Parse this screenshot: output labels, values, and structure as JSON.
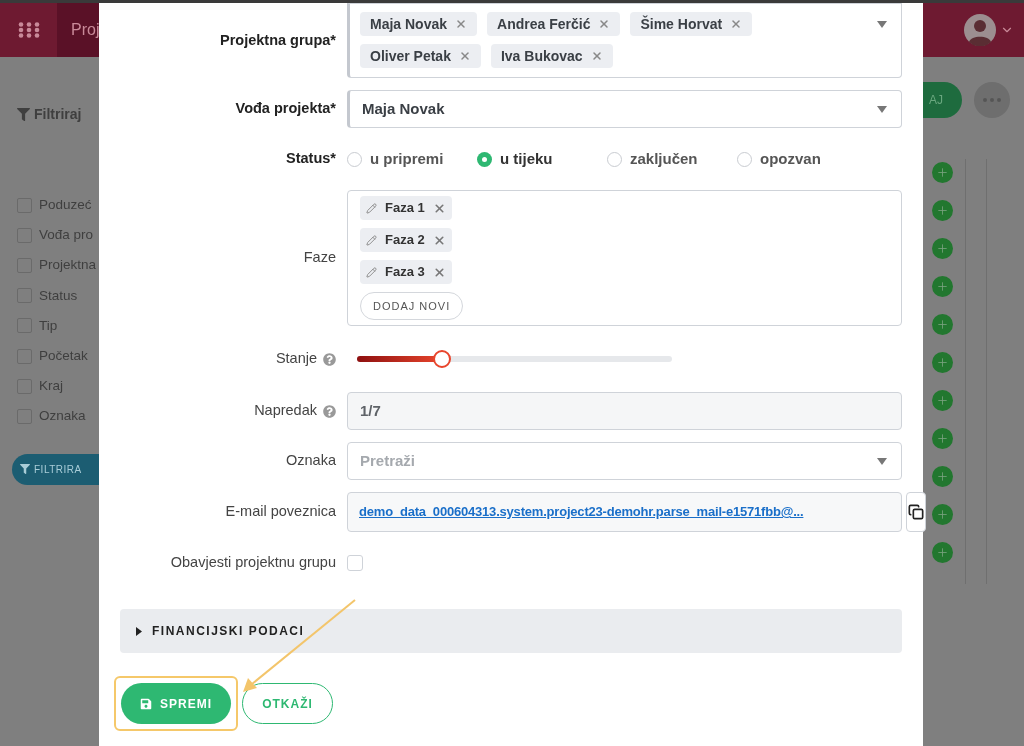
{
  "background": {
    "header": {
      "title": "Proj"
    },
    "filter": {
      "title": "Filtriraj",
      "button": "FILTRIRA",
      "items": [
        {
          "label": "Poduzeć",
          "checked": false
        },
        {
          "label": "Vođa pro",
          "checked": false
        },
        {
          "label": "Projektna",
          "checked": false
        },
        {
          "label": "Status",
          "checked": false
        },
        {
          "label": "Tip",
          "checked": false
        },
        {
          "label": "Početak",
          "checked": false
        },
        {
          "label": "Kraj",
          "checked": false
        },
        {
          "label": "Oznaka",
          "checked": false
        }
      ]
    },
    "add_button": "AJ"
  },
  "form": {
    "fields": [
      {
        "kind": "tags",
        "label": "Projektna grupa*",
        "required": true,
        "tags": [
          "Maja Novak",
          "Andrea Ferčić",
          "Šime Horvat",
          "Oliver Petak",
          "Iva Bukovac"
        ]
      },
      {
        "kind": "select",
        "label": "Vođa projekta*",
        "required": true,
        "value": "Maja Novak"
      },
      {
        "kind": "radio",
        "label": "Status*",
        "required": true,
        "options": [
          {
            "label": "u pripremi",
            "selected": false
          },
          {
            "label": "u tijeku",
            "selected": true
          },
          {
            "label": "zaključen",
            "selected": false
          },
          {
            "label": "opozvan",
            "selected": false
          }
        ]
      },
      {
        "kind": "phases",
        "label": "Faze",
        "required": false,
        "phases": [
          "Faza 1",
          "Faza 2",
          "Faza 3"
        ],
        "add_button": "DODAJ NOVI"
      },
      {
        "kind": "slider",
        "label": "Stanje",
        "required": false,
        "help": true,
        "level": 0.27
      },
      {
        "kind": "readonly",
        "label": "Napredak",
        "required": false,
        "help": true,
        "value": "1/7"
      },
      {
        "kind": "select",
        "label": "Oznaka",
        "required": false,
        "placeholder": "Pretraži"
      },
      {
        "kind": "link",
        "label": "E-mail poveznica",
        "required": false,
        "value": "demo_data_000604313.system.project23-demohr.parse_mail-e1571fbb@..."
      },
      {
        "kind": "checkbox",
        "label": "Obavjesti projektnu grupu",
        "required": false,
        "checked": false
      }
    ],
    "accordion": {
      "title": "FINANCIJSKI PODACI",
      "expanded": false
    },
    "buttons": [
      {
        "label": "SPREMI",
        "kind": "primary",
        "highlighted": true
      },
      {
        "label": "OTKAŽI",
        "kind": "secondary",
        "highlighted": false
      }
    ]
  }
}
